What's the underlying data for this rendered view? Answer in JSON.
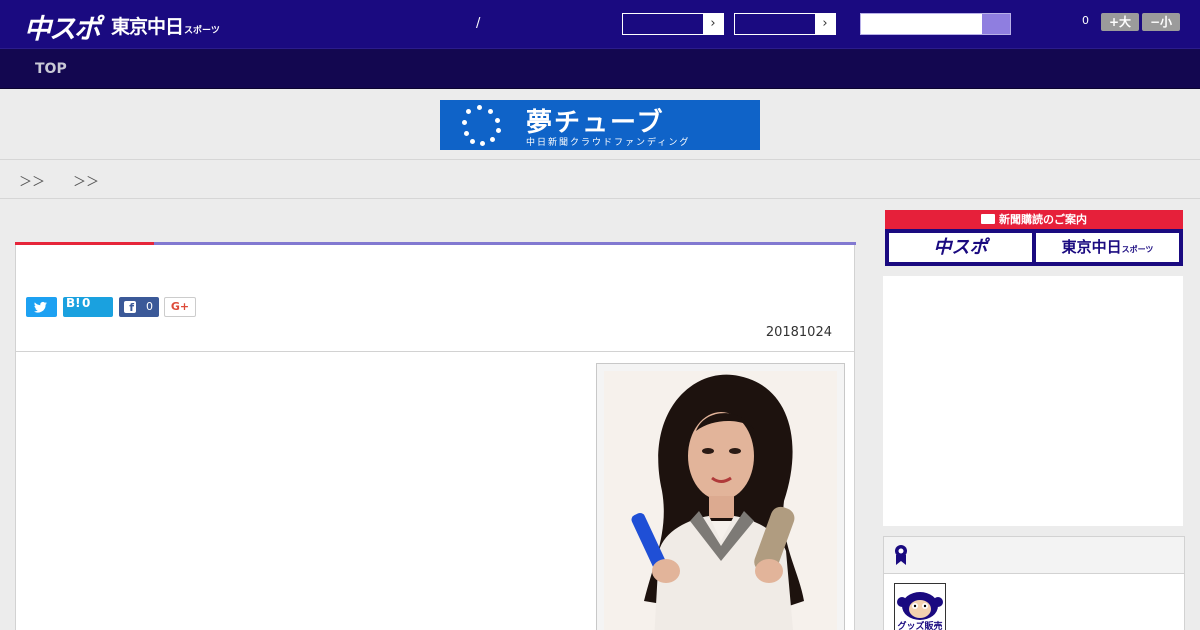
{
  "header": {
    "logo_chuspo": "中スポ",
    "logo_tokyo": "東京中日",
    "logo_tokyo_suffix": "スポーツ",
    "slash": "/",
    "font_size": {
      "count": "0",
      "increase_label": "+大",
      "decrease_label": "−小"
    }
  },
  "nav": {
    "items": [
      {
        "label": "TOP"
      }
    ]
  },
  "banner": {
    "title": "夢チューブ",
    "subtitle": "中日新聞クラウドファンディング"
  },
  "breadcrumb": {
    "sep1": "＞＞",
    "sep2": "＞＞"
  },
  "article": {
    "share": {
      "twitter_icon": "twitter-icon",
      "hatena_label": "B!",
      "hatena_count": "0",
      "facebook_count": "0",
      "gplus_label": "G+"
    },
    "date": "20181024"
  },
  "sidebar": {
    "subscription_header": "新聞購読のご案内",
    "subscription_chuspo": "中スポ",
    "subscription_tokyo": "東京中日",
    "subscription_tokyo_suffix": "スポーツ",
    "goods_label": "グッズ販売中"
  },
  "colors": {
    "header_bg": "#1a0a80",
    "nav_bg": "#130750",
    "accent_red": "#e6253a",
    "accent_purple": "#8279d1"
  }
}
